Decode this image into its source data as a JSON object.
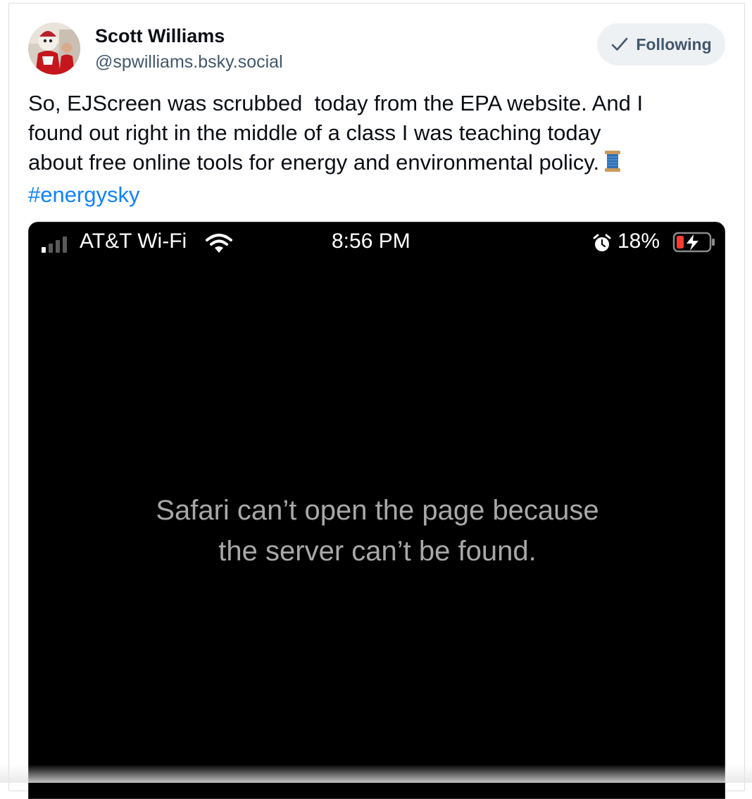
{
  "post": {
    "author": {
      "display_name": "Scott Williams",
      "handle": "@spwilliams.bsky.social"
    },
    "follow_button": {
      "label": "Following",
      "icon": "checkmark-icon"
    },
    "text_lines": [
      "So, EJScreen was scrubbed  today from the EPA website. And I",
      "found out right in the middle of a class I was teaching today",
      "about free online tools for energy and environmental policy."
    ],
    "emoji": "thread-spool-icon",
    "hashtag": "#energysky"
  },
  "screenshot": {
    "status_bar": {
      "carrier": "AT&T Wi-Fi",
      "time": "8:56 PM",
      "battery": "18%",
      "icons": [
        "signal-bars-icon",
        "wifi-icon",
        "alarm-icon",
        "battery-charging-icon"
      ]
    },
    "error_lines": [
      "Safari can’t open the page because",
      "the server can’t be found."
    ]
  },
  "colors": {
    "hashtag": "#1083fe",
    "handle": "#42576c",
    "follow_bg": "#eef1f4",
    "error_text": "#a8a8a8"
  }
}
